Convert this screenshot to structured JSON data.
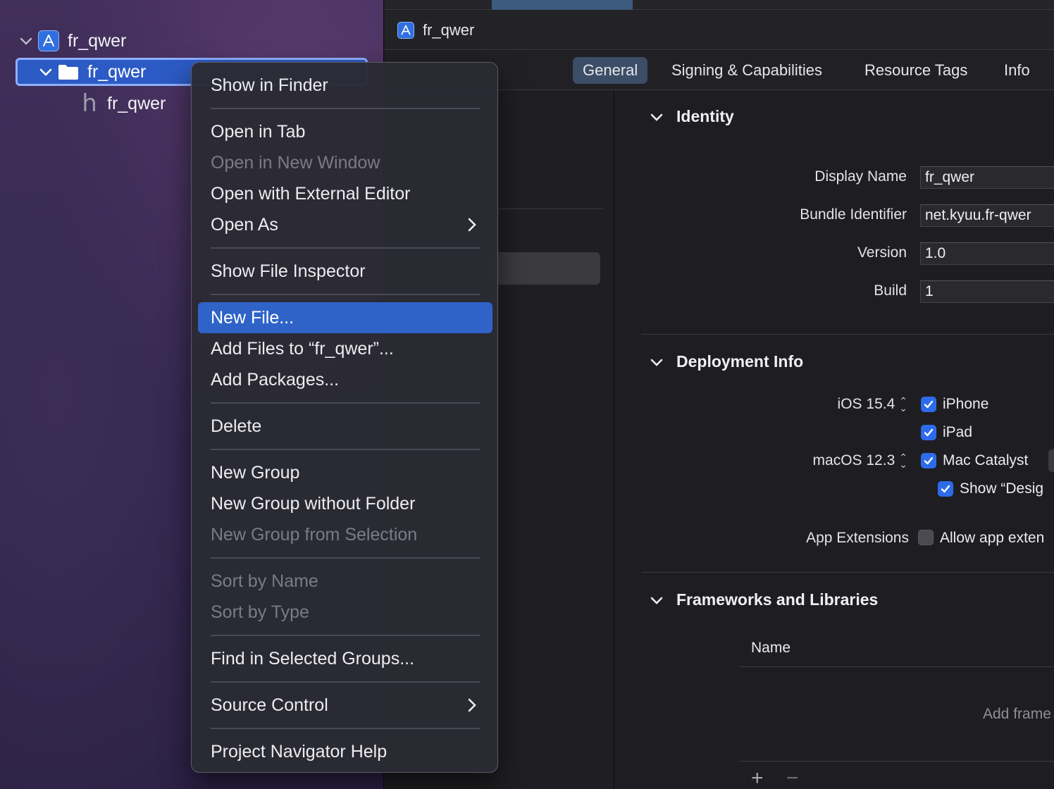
{
  "navigator": {
    "project_name": "fr_qwer",
    "group_name": "fr_qwer",
    "file_name": "fr_qwer"
  },
  "jumpbar": {
    "title": "fr_qwer"
  },
  "tabs": [
    {
      "label": "General",
      "active": true
    },
    {
      "label": "Signing & Capabilities",
      "active": false
    },
    {
      "label": "Resource Tags",
      "active": false
    },
    {
      "label": "Info",
      "active": false
    }
  ],
  "identity": {
    "title": "Identity",
    "fields": [
      {
        "label": "Display Name",
        "value": "fr_qwer"
      },
      {
        "label": "Bundle Identifier",
        "value": "net.kyuu.fr-qwer"
      },
      {
        "label": "Version",
        "value": "1.0"
      },
      {
        "label": "Build",
        "value": "1"
      }
    ]
  },
  "deployment": {
    "title": "Deployment Info",
    "ios_version": "iOS 15.4",
    "macos_version": "macOS 12.3",
    "iphone_label": "iPhone",
    "ipad_label": "iPad",
    "mac_catalyst_label": "Mac Catalyst",
    "show_designed_label": "Show “Desig",
    "app_extensions_label": "App Extensions",
    "allow_extensions_label": "Allow app exten",
    "checks": {
      "iphone": true,
      "ipad": true,
      "mac_catalyst": true,
      "show_designed": true,
      "allow_extensions": false
    }
  },
  "frameworks": {
    "title": "Frameworks and Libraries",
    "column_name": "Name",
    "empty_text": "Add frame",
    "add_button": "+",
    "remove_button": "−"
  },
  "context_menu": {
    "items": [
      {
        "label": "Show in Finder",
        "enabled": true
      },
      {
        "label": "Open in Tab",
        "enabled": true
      },
      {
        "label": "Open in New Window",
        "enabled": false
      },
      {
        "label": "Open with External Editor",
        "enabled": true
      },
      {
        "label": "Open As",
        "enabled": true,
        "submenu": true
      },
      {
        "label": "Show File Inspector",
        "enabled": true
      },
      {
        "label": "New File...",
        "enabled": true,
        "highlighted": true
      },
      {
        "label": "Add Files to “fr_qwer”...",
        "enabled": true
      },
      {
        "label": "Add Packages...",
        "enabled": true
      },
      {
        "label": "Delete",
        "enabled": true
      },
      {
        "label": "New Group",
        "enabled": true
      },
      {
        "label": "New Group without Folder",
        "enabled": true
      },
      {
        "label": "New Group from Selection",
        "enabled": false
      },
      {
        "label": "Sort by Name",
        "enabled": false
      },
      {
        "label": "Sort by Type",
        "enabled": false
      },
      {
        "label": "Find in Selected Groups...",
        "enabled": true
      },
      {
        "label": "Source Control",
        "enabled": true,
        "submenu": true
      },
      {
        "label": "Project Navigator Help",
        "enabled": true
      }
    ]
  },
  "colors": {
    "accent": "#2f63c8",
    "checkbox": "#2d6bea",
    "sidebar": "#3a2a55"
  }
}
